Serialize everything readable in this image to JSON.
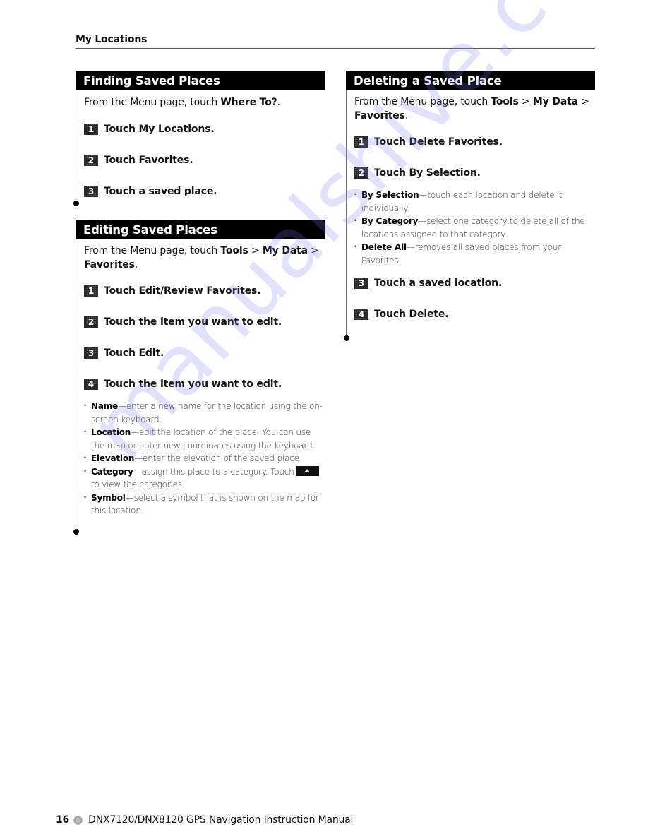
{
  "header": {
    "running_title": "My Locations"
  },
  "sections": {
    "finding": {
      "title": "Finding Saved Places",
      "intro_prefix": "From the Menu page, touch ",
      "intro_bold": "Where To?",
      "intro_suffix": ".",
      "steps": [
        {
          "num": "1",
          "text": "Touch My Locations."
        },
        {
          "num": "2",
          "text": "Touch Favorites."
        },
        {
          "num": "3",
          "text": "Touch a saved place."
        }
      ]
    },
    "editing": {
      "title": "Editing Saved Places",
      "intro_prefix": "From the Menu page, touch ",
      "intro_bold_1": "Tools",
      "intro_sep": " > ",
      "intro_bold_2": "My Data",
      "intro_sep_2": " > ",
      "intro_bold_3": "Favorites",
      "intro_suffix": ".",
      "steps": [
        {
          "num": "1",
          "text": "Touch Edit/Review Favorites."
        },
        {
          "num": "2",
          "text": "Touch the item you want to edit."
        },
        {
          "num": "3",
          "text": "Touch Edit."
        },
        {
          "num": "4",
          "text": "Touch the item you want to edit."
        }
      ],
      "bullets": [
        {
          "term": "Name",
          "desc": "—enter a new name for the location using the on-screen keyboard."
        },
        {
          "term": "Location",
          "desc": "—edit the location of the place. You can use the map or enter new coordinates using the keyboard."
        },
        {
          "term": "Elevation",
          "desc": "—enter the elevation of the saved place."
        },
        {
          "term": "Category",
          "desc": "—assign this place to a category. Touch",
          "icon": "up-arrow-button-icon",
          "desc_after": " to view the categories."
        },
        {
          "term": "Symbol",
          "desc": "—select a symbol that is shown on the map for this location."
        }
      ]
    },
    "deleting": {
      "title": "Deleting a Saved Place",
      "intro_prefix": "From the Menu page, touch ",
      "intro_bold_1": "Tools",
      "intro_sep": " > ",
      "intro_bold_2": "My Data",
      "intro_sep_2": " > ",
      "intro_bold_3": "Favorites",
      "intro_suffix": ".",
      "steps": [
        {
          "num": "1",
          "text": "Touch Delete Favorites."
        },
        {
          "num": "2",
          "text": "Touch By Selection."
        },
        {
          "num": "3",
          "text": "Touch a saved location."
        },
        {
          "num": "4",
          "text": "Touch Delete."
        }
      ],
      "bullets": [
        {
          "term": "By Selection",
          "desc": "—touch each location and delete it individually."
        },
        {
          "term": "By Category",
          "desc": "—select one category to delete all of the locations assigned to that category."
        },
        {
          "term": "Delete All",
          "desc": "—removes all saved places from your Favorites."
        }
      ]
    }
  },
  "footer": {
    "page_number": "16",
    "icon": "gear-bullet-icon",
    "manual_title": "DNX7120/DNX8120 GPS Navigation Instruction Manual"
  },
  "watermark": {
    "text": "manualshive.com",
    "color": "#7878eb"
  }
}
